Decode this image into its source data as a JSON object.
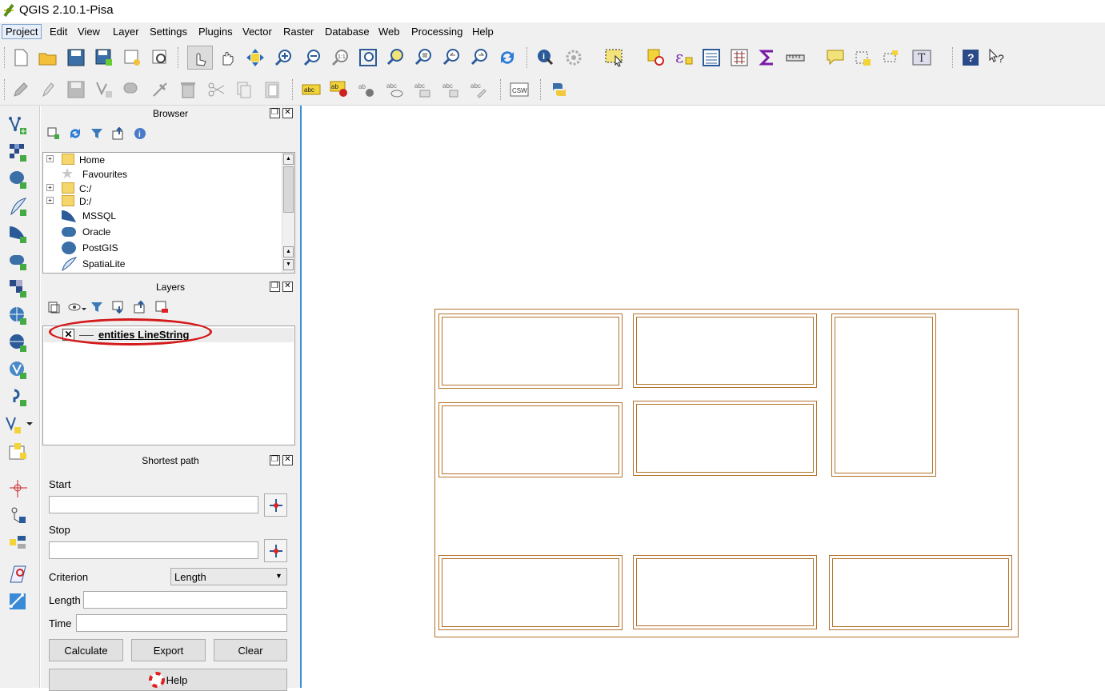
{
  "window": {
    "title": "QGIS 2.10.1-Pisa"
  },
  "menu": [
    "Project",
    "Edit",
    "View",
    "Layer",
    "Settings",
    "Plugins",
    "Vector",
    "Raster",
    "Database",
    "Web",
    "Processing",
    "Help"
  ],
  "browser": {
    "title": "Browser",
    "items": [
      "Home",
      "Favourites",
      "C:/",
      "D:/",
      "MSSQL",
      "Oracle",
      "PostGIS",
      "SpatiaLite"
    ]
  },
  "layers": {
    "title": "Layers",
    "items": [
      {
        "name": "entities LineString",
        "checked": true
      }
    ]
  },
  "shortest_path": {
    "title": "Shortest path",
    "start_label": "Start",
    "start_value": "",
    "stop_label": "Stop",
    "stop_value": "",
    "criterion_label": "Criterion",
    "criterion_value": "Length",
    "length_label": "Length",
    "length_value": "",
    "time_label": "Time",
    "time_value": "",
    "calculate_label": "Calculate",
    "export_label": "Export",
    "clear_label": "Clear",
    "help_label": "Help"
  },
  "toolbar1_icons": [
    "new-project-icon",
    "open-project-icon",
    "save-project-icon",
    "save-as-icon",
    "new-print-composer-icon",
    "composer-manager-icon",
    "touch-icon",
    "pan-icon",
    "pan-to-selection-icon",
    "zoom-in-icon",
    "zoom-out-icon",
    "zoom-native-icon",
    "zoom-full-icon",
    "zoom-to-selection-icon",
    "zoom-to-layer-icon",
    "zoom-last-icon",
    "zoom-next-icon",
    "refresh-icon",
    "identify-icon",
    "action-icon",
    "select-icon",
    "deselect-icon",
    "expression-select-icon",
    "attribute-table-icon",
    "field-calculator-icon",
    "statistics-icon",
    "measure-icon",
    "map-tips-icon",
    "new-bookmark-icon",
    "show-bookmarks-icon",
    "text-annotation-icon",
    "help-contents-icon",
    "whats-this-icon"
  ],
  "toolbar2_icons": [
    "current-edits-icon",
    "toggle-editing-icon",
    "save-edits-icon",
    "add-feature-icon",
    "move-feature-icon",
    "node-tool-icon",
    "delete-selected-icon",
    "cut-features-icon",
    "copy-features-icon",
    "paste-features-icon",
    "label-icon",
    "pin-labels-icon",
    "highlight-pinned-icon",
    "show-hide-labels-icon",
    "move-label-icon",
    "rotate-label-icon",
    "change-label-icon",
    "csw-icon",
    "python-console-icon"
  ],
  "leftbar_icons": [
    "add-vector-layer-icon",
    "add-raster-layer-icon",
    "add-postgis-layer-icon",
    "add-spatialite-layer-icon",
    "add-mssql-layer-icon",
    "add-oracle-layer-icon",
    "add-wms-layer-icon",
    "add-wcs-layer-icon",
    "add-wfs-layer-icon",
    "add-delimited-text-icon",
    "new-shapefile-icon",
    "new-spatialite-icon",
    "new-temp-layer-icon",
    "add-virtual-layer-icon",
    "digitize-icon",
    "advanced-digitize-icon",
    "snapping-icon",
    "topology-icon",
    "georeferencer-icon"
  ]
}
